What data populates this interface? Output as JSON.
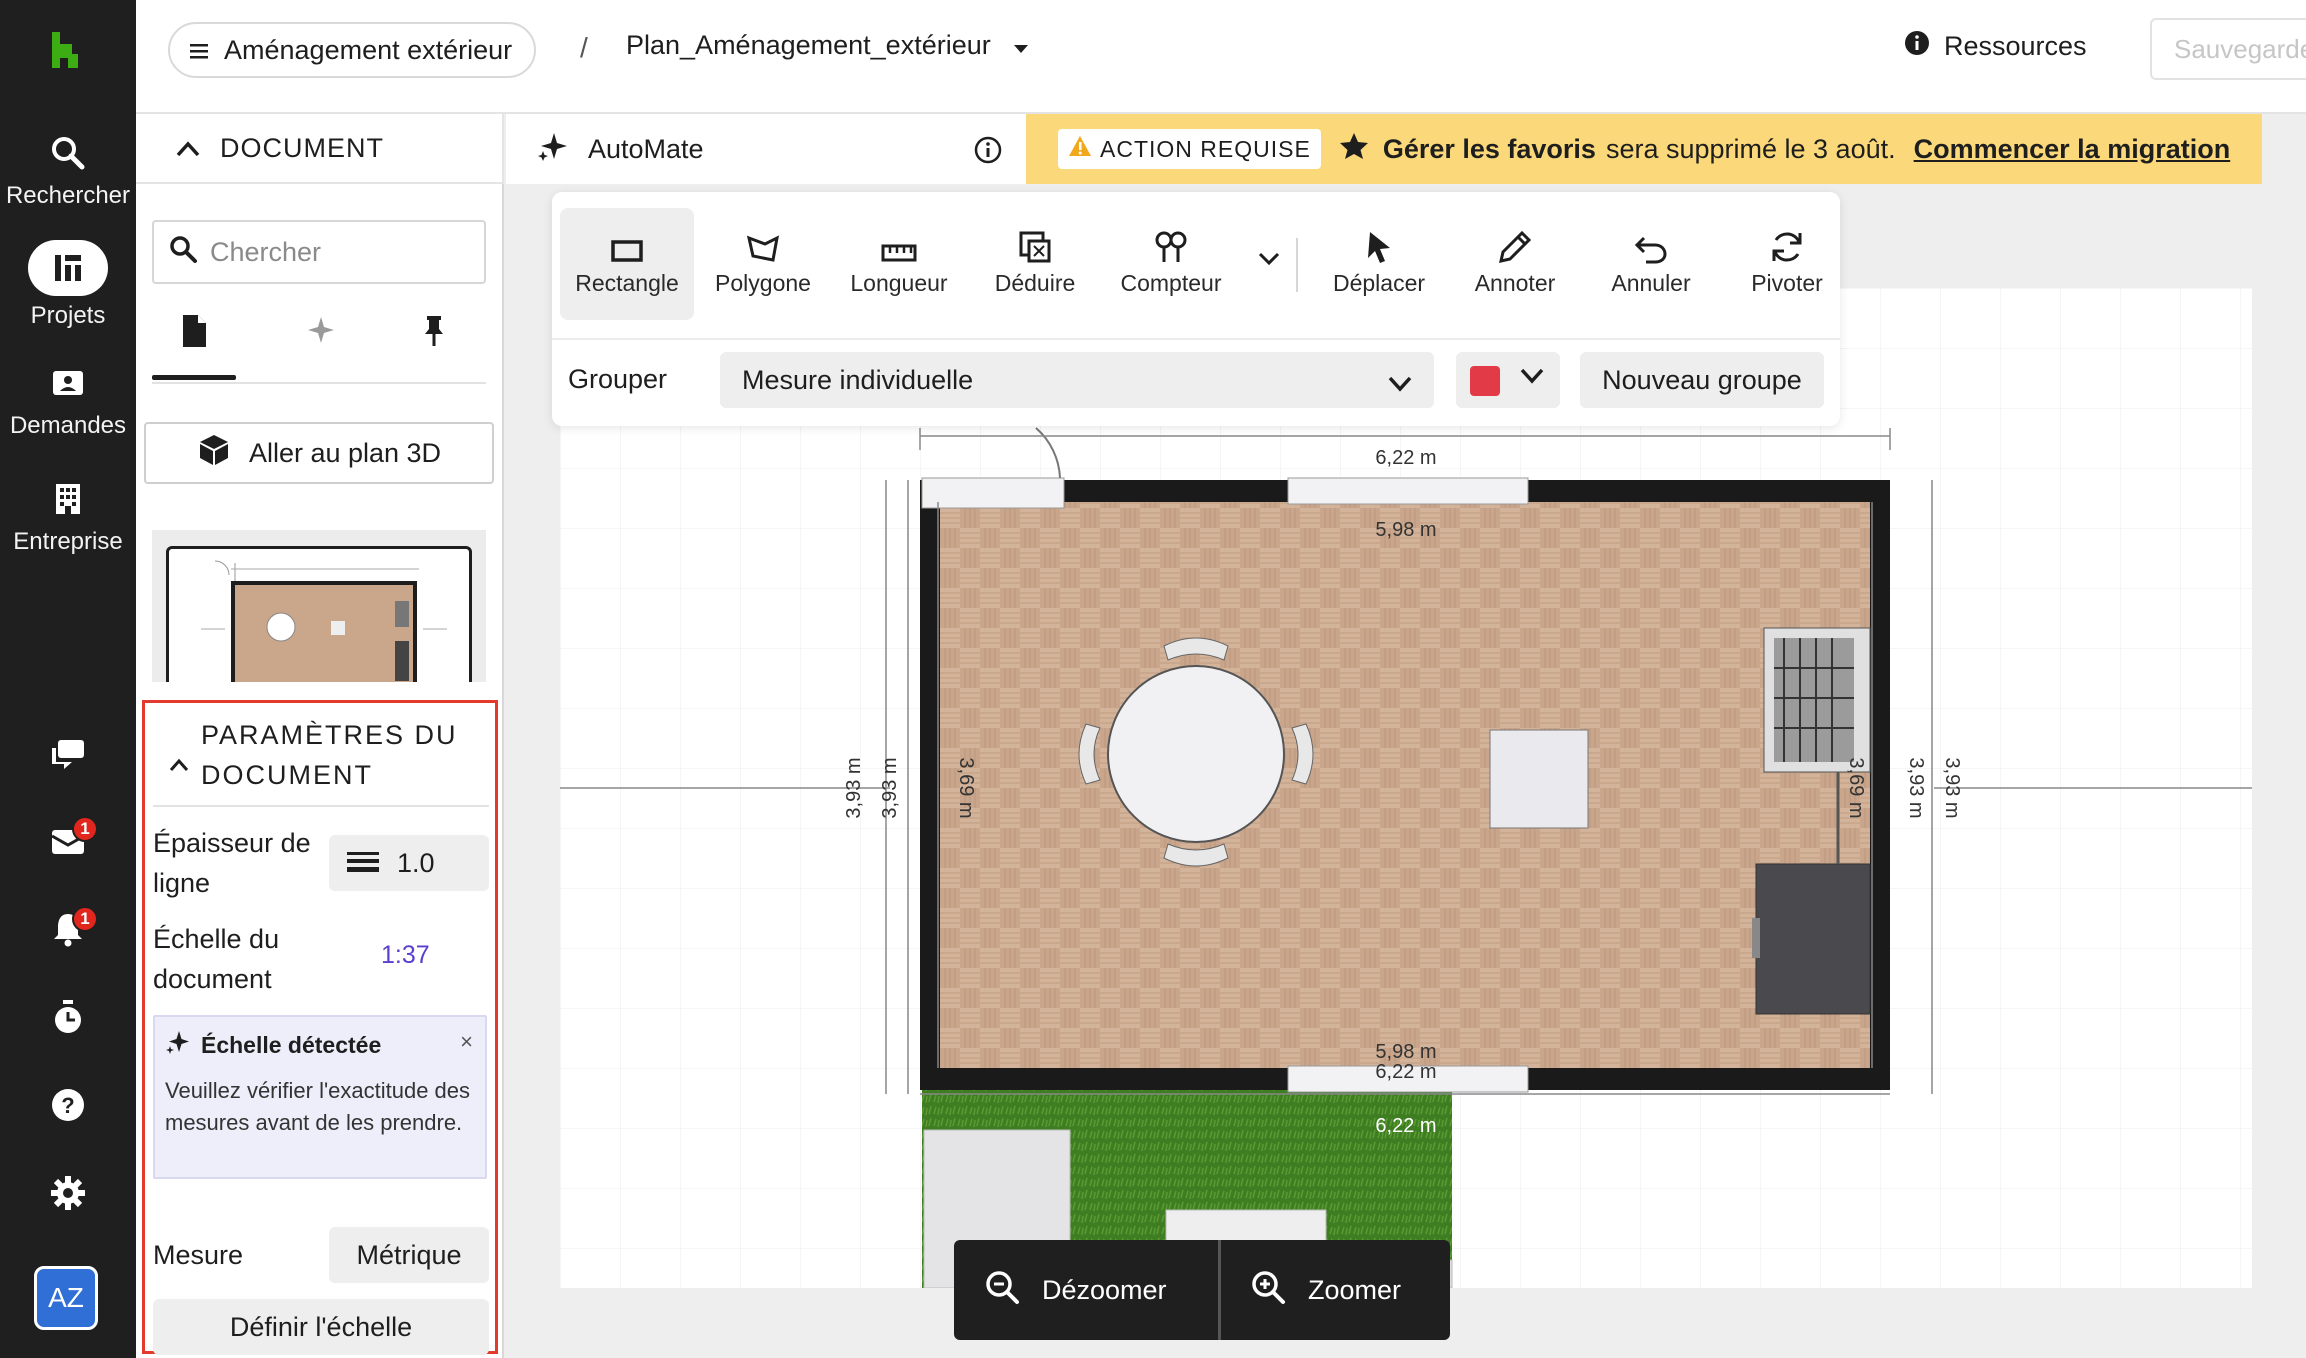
{
  "app": {
    "brand_color": "#3dad14"
  },
  "nav": {
    "items": [
      {
        "label": "Rechercher",
        "icon": "search-icon"
      },
      {
        "label": "Projets",
        "icon": "projects-icon"
      },
      {
        "label": "Demandes",
        "icon": "requests-icon"
      },
      {
        "label": "Entreprise",
        "icon": "building-icon"
      }
    ],
    "messages_badge": "1",
    "notifications_badge": "1",
    "avatar": "AZ"
  },
  "header": {
    "project": "Aménagement extérieur",
    "separator": "/",
    "file": "Plan_Aménagement_extérieur",
    "resources": "Ressources",
    "save": "Sauvegarder"
  },
  "panel": {
    "section": "DOCUMENT",
    "search_placeholder": "Chercher",
    "plan3d": "Aller au plan 3D",
    "settings_title": "PARAMÈTRES DU DOCUMENT",
    "line_width_label": "Épaisseur de ligne",
    "line_width_value": "1.0",
    "scale_label": "Échelle du document",
    "scale_value": "1:37",
    "detect_title": "Échelle détectée",
    "detect_close": "×",
    "detect_body": "Veuillez vérifier l'exactitude des mesures avant de les prendre.",
    "measure_label": "Mesure",
    "measure_value": "Métrique",
    "define_scale": "Définir l'échelle"
  },
  "automate": {
    "label": "AutoMate"
  },
  "banner": {
    "tag": "ACTION REQUISE",
    "bold": "Gérer les favoris",
    "text": "sera supprimé le 3 août.",
    "link": "Commencer la migration",
    "color": "#fbd97a"
  },
  "toolbar": {
    "tools": [
      "Rectangle",
      "Polygone",
      "Longueur",
      "Déduire",
      "Compteur",
      "Déplacer",
      "Annoter",
      "Annuler",
      "Pivoter"
    ],
    "group_label": "Grouper",
    "group_value": "Mesure individuelle",
    "group_color": "#e23a46",
    "new_group": "Nouveau groupe"
  },
  "plan": {
    "dim_top_outer": "6,22 m",
    "dim_top_inner": "5,98 m",
    "dim_bottom_inner": "5,98 m",
    "dim_bottom_outer": "6,22 m",
    "dim_garden": "6,22 m",
    "dim_left_a": "3,93 m",
    "dim_left_b": "3,93 m",
    "dim_left_c": "3,69 m",
    "dim_right_a": "3,69 m",
    "dim_right_b": "3,93 m",
    "dim_right_c": "3,93 m"
  },
  "zoom": {
    "out": "Dézoomer",
    "in": "Zoomer"
  }
}
